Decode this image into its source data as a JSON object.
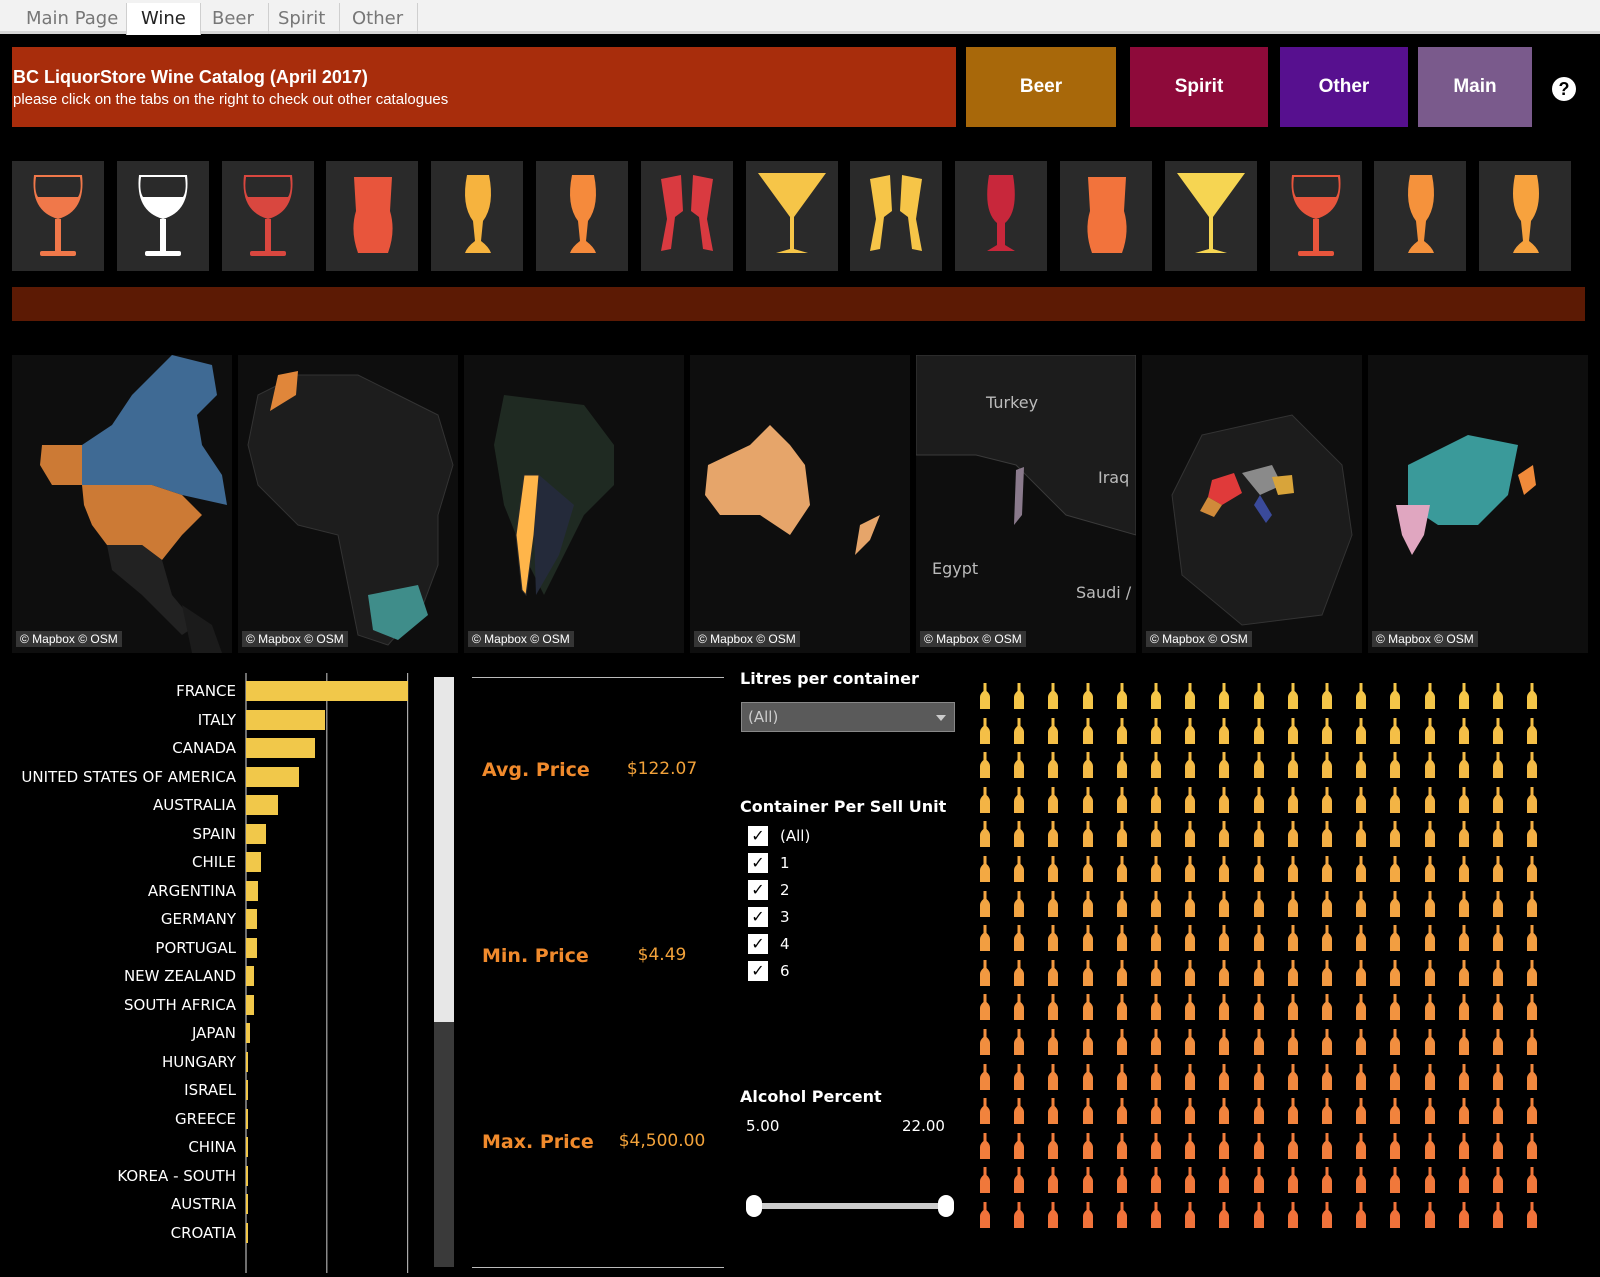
{
  "tabs": [
    "Main Page",
    "Wine",
    "Beer",
    "Spirit",
    "Other"
  ],
  "active_tab": "Wine",
  "banner": {
    "title": "BC LiquorStore Wine Catalog (April 2017)",
    "subtitle": "please click on the tabs on the right to check out other catalogues",
    "color": "#a82d0c"
  },
  "nav_buttons": [
    {
      "label": "Beer",
      "color": "#a8680a"
    },
    {
      "label": "Spirit",
      "color": "#8e0a3a"
    },
    {
      "label": "Other",
      "color": "#57108f"
    },
    {
      "label": "Main",
      "color": "#7a5a8c"
    }
  ],
  "help_icon": "question-circle-icon",
  "glass_icons": [
    {
      "icon": "wine-glass-icon",
      "color": "#f0784a"
    },
    {
      "icon": "wine-glass-icon",
      "color": "#ffffff"
    },
    {
      "icon": "wine-glass-icon",
      "color": "#d9473f"
    },
    {
      "icon": "tumbler-glass-icon",
      "color": "#e8553c"
    },
    {
      "icon": "tulip-glass-icon",
      "color": "#f6b33e"
    },
    {
      "icon": "tulip-glass-icon",
      "color": "#f58a3c"
    },
    {
      "icon": "toast-glasses-icon",
      "color": "#d93a40"
    },
    {
      "icon": "martini-glass-icon",
      "color": "#f6c548"
    },
    {
      "icon": "toast-glasses-icon",
      "color": "#f6c548"
    },
    {
      "icon": "goblet-glass-icon",
      "color": "#c8273b"
    },
    {
      "icon": "tumbler-glass-icon",
      "color": "#f2733c"
    },
    {
      "icon": "martini-glass-icon",
      "color": "#f6d552"
    },
    {
      "icon": "wine-glass-icon",
      "color": "#e8553c"
    },
    {
      "icon": "tulip-glass-icon",
      "color": "#f5923c"
    },
    {
      "icon": "tulip-glass-icon",
      "color": "#f7a23e"
    }
  ],
  "maps": {
    "attribution": "© Mapbox © OSM",
    "labels": {
      "turkey": "Turkey",
      "iraq": "Iraq",
      "egypt": "Egypt",
      "saudi": "Saudi /"
    }
  },
  "chart_data": {
    "type": "bar",
    "orientation": "horizontal",
    "categories": [
      "FRANCE",
      "ITALY",
      "CANADA",
      "UNITED STATES OF AMERICA",
      "AUSTRALIA",
      "SPAIN",
      "CHILE",
      "ARGENTINA",
      "GERMANY",
      "PORTUGAL",
      "NEW ZEALAND",
      "SOUTH AFRICA",
      "JAPAN",
      "HUNGARY",
      "ISRAEL",
      "GREECE",
      "CHINA",
      "KOREA - SOUTH",
      "AUSTRIA",
      "CROATIA"
    ],
    "values": [
      1000,
      487,
      425,
      325,
      200,
      126,
      90,
      76,
      70,
      66,
      52,
      48,
      22,
      6,
      5,
      4,
      3,
      3,
      3,
      2
    ],
    "xlim": [
      0,
      1200
    ],
    "gridlines": [
      500,
      1000
    ],
    "color": "#f1c84a"
  },
  "kpis": [
    {
      "label": "Avg. Price",
      "value": "$122.07"
    },
    {
      "label": "Min. Price",
      "value": "$4.49"
    },
    {
      "label": "Max. Price",
      "value": "$4,500.00"
    }
  ],
  "filters": {
    "litres_title": "Litres per container",
    "litres_value": "(All)",
    "container_title": "Container Per Sell Unit",
    "container_options": [
      "(All)",
      "1",
      "2",
      "3",
      "4",
      "6"
    ],
    "alcohol_title": "Alcohol Percent",
    "alcohol_min": "5.00",
    "alcohol_max": "22.00"
  },
  "bottle_grid": {
    "columns": 17,
    "rows": 16,
    "top_color": "#f4c548",
    "bottom_color": "#f0723a"
  }
}
